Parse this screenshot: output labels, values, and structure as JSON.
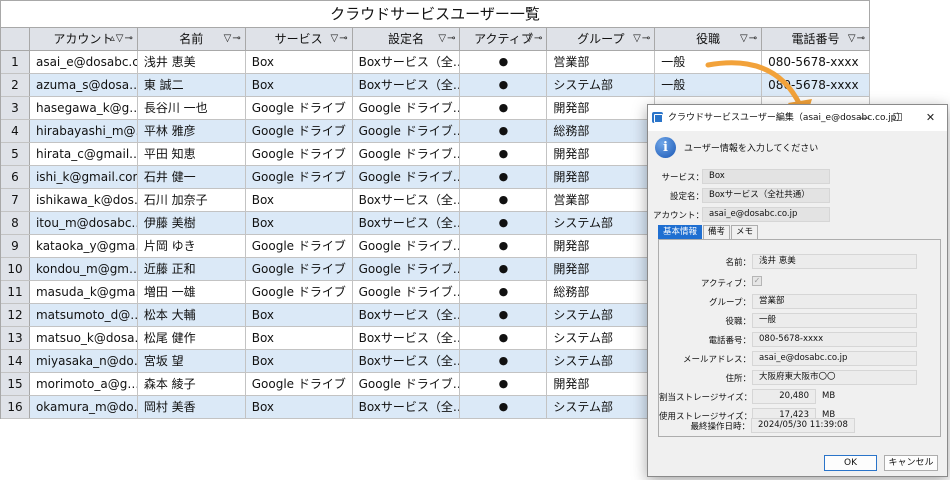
{
  "grid": {
    "title": "クラウドサービスユーザー一覧",
    "headers": [
      "",
      "アカウント",
      "名前",
      "サービス",
      "設定名",
      "アクティブ",
      "グループ",
      "役職",
      "電話番号"
    ],
    "header_icons": [
      "",
      "sort-asc-icon filter-icon pin-icon",
      "filter-icon pin-icon",
      "filter-icon pin-icon",
      "filter-icon pin-icon",
      "filter-icon pin-icon",
      "filter-icon pin-icon",
      "filter-icon pin-icon",
      "filter-icon pin-icon"
    ],
    "rows": [
      [
        "1",
        "asai_e@dosabc.co",
        "浅井 恵美",
        "Box",
        "Boxサービス（全…",
        "●",
        "営業部",
        "一般",
        "080-5678-xxxx"
      ],
      [
        "2",
        "azuma_s@dosa…",
        "東 誠二",
        "Box",
        "Boxサービス（全…",
        "●",
        "システム部",
        "一般",
        "080-5678-xxxx"
      ],
      [
        "3",
        "hasegawa_k@g…",
        "長谷川 一也",
        "Google ドライブ",
        "Google ドライブ…",
        "●",
        "開発部",
        "",
        ""
      ],
      [
        "4",
        "hirabayashi_m@…",
        "平林 雅彦",
        "Google ドライブ",
        "Google ドライブ…",
        "●",
        "総務部",
        "",
        ""
      ],
      [
        "5",
        "hirata_c@gmail.…",
        "平田 知恵",
        "Google ドライブ",
        "Google ドライブ…",
        "●",
        "開発部",
        "",
        ""
      ],
      [
        "6",
        "ishi_k@gmail.com",
        "石井 健一",
        "Google ドライブ",
        "Google ドライブ…",
        "●",
        "開発部",
        "",
        ""
      ],
      [
        "7",
        "ishikawa_k@dos…",
        "石川 加奈子",
        "Box",
        "Boxサービス（全…",
        "●",
        "営業部",
        "",
        ""
      ],
      [
        "8",
        "itou_m@dosabc…",
        "伊藤 美樹",
        "Box",
        "Boxサービス（全…",
        "●",
        "システム部",
        "",
        ""
      ],
      [
        "9",
        "kataoka_y@gma…",
        "片岡 ゆき",
        "Google ドライブ",
        "Google ドライブ…",
        "●",
        "開発部",
        "",
        ""
      ],
      [
        "10",
        "kondou_m@gm…",
        "近藤 正和",
        "Google ドライブ",
        "Google ドライブ…",
        "●",
        "開発部",
        "",
        ""
      ],
      [
        "11",
        "masuda_k@gma…",
        "増田 一雄",
        "Google ドライブ",
        "Google ドライブ…",
        "●",
        "総務部",
        "",
        ""
      ],
      [
        "12",
        "matsumoto_d@…",
        "松本 大輔",
        "Box",
        "Boxサービス（全…",
        "●",
        "システム部",
        "",
        ""
      ],
      [
        "13",
        "matsuo_k@dosa…",
        "松尾 健作",
        "Box",
        "Boxサービス（全…",
        "●",
        "システム部",
        "",
        ""
      ],
      [
        "14",
        "miyasaka_n@do…",
        "宮坂 望",
        "Box",
        "Boxサービス（全…",
        "●",
        "システム部",
        "",
        ""
      ],
      [
        "15",
        "morimoto_a@g…",
        "森本 綾子",
        "Google ドライブ",
        "Google ドライブ…",
        "●",
        "開発部",
        "",
        ""
      ],
      [
        "16",
        "okamura_m@do…",
        "岡村 美香",
        "Box",
        "Boxサービス（全…",
        "●",
        "システム部",
        "",
        ""
      ]
    ]
  },
  "dialog": {
    "title": "クラウドサービスユーザー編集（asai_e@dosabc.co.jp）",
    "window_buttons": [
      "—",
      "☐",
      "✕"
    ],
    "info_icon": "i",
    "info_text": "ユーザー情報を入力してください",
    "service_label": "サービス：",
    "service_value": "Box",
    "setting_label": "設定名：",
    "setting_value": "Boxサービス（全社共通）",
    "account_label": "アカウント：",
    "account_value": "asai_e@dosabc.co.jp",
    "tabs": [
      "基本情報",
      "備考",
      "メモ"
    ],
    "fields": {
      "name_label": "名前：",
      "name_value": "浅井 恵美",
      "active_label": "アクティブ：",
      "active_checked": true,
      "group_label": "グループ：",
      "group_value": "営業部",
      "position_label": "役職：",
      "position_value": "一般",
      "phone_label": "電話番号：",
      "phone_value": "080-5678-xxxx",
      "mail_label": "メールアドレス：",
      "mail_value": "asai_e@dosabc.co.jp",
      "address_label": "住所：",
      "address_value": "大阪府東大阪市〇〇",
      "alloc_label": "割当ストレージサイズ：",
      "alloc_value": "20,480",
      "alloc_unit": "MB",
      "used_label": "使用ストレージサイズ：",
      "used_value": "17,423",
      "used_unit": "MB",
      "last_label": "最終操作日時：",
      "last_value": "2024/05/30 11:39:08"
    },
    "ok_label": "OK",
    "cancel_label": "キャンセル"
  },
  "colors": {
    "header_bg": "#dfe2e8",
    "alt_row": "#dbe9f7",
    "arrow": "#f2a23a",
    "accent": "#1f6fd1"
  }
}
